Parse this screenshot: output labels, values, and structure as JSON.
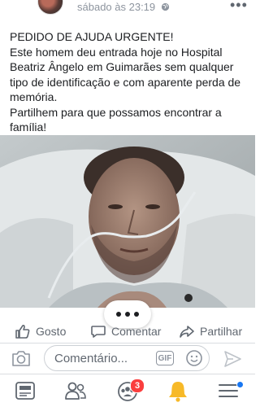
{
  "post": {
    "timestamp": "sábado às 23:19",
    "privacy_icon": "globe-icon",
    "paragraphs": [
      "PEDIDO DE AJUDA URGENTE!",
      "Este homem deu entrada hoje no Hospital Beatriz Ângelo em Guimarães sem qualquer tipo de identificação e com aparente perda de memória.",
      "Partilhem para que possamos encontrar a família!"
    ],
    "photo_icon": "hospital-patient-photo"
  },
  "actions": {
    "like_label": "Gosto",
    "comment_label": "Comentar",
    "share_label": "Partilhar"
  },
  "comment_box": {
    "placeholder": "Comentário...",
    "gif_label": "GIF"
  },
  "tab_bar": {
    "groups_badge": "3",
    "active_color": "#f7b928",
    "badge_color": "#fa3e3e",
    "accent_color": "#1877f2"
  }
}
